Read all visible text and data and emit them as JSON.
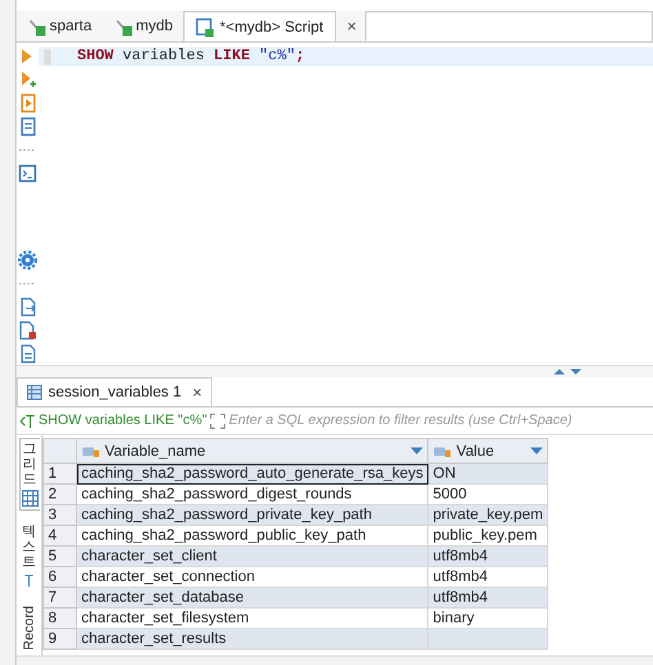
{
  "editor_tabs": [
    {
      "label": "sparta",
      "kind": "connection",
      "selected": false
    },
    {
      "label": "mydb",
      "kind": "connection",
      "selected": false
    },
    {
      "label": "*<mydb> Script",
      "kind": "script",
      "selected": true,
      "close": "×"
    }
  ],
  "editor": {
    "tokens": [
      {
        "text": "SHOW",
        "kind": "keyword"
      },
      {
        "text": " variables ",
        "kind": "plain"
      },
      {
        "text": "LIKE",
        "kind": "keyword"
      },
      {
        "text": " \"c%\"",
        "kind": "string"
      },
      {
        "text": ";",
        "kind": "keyword"
      }
    ]
  },
  "results_tab": {
    "label": "session_variables 1",
    "close": "×"
  },
  "filter": {
    "query": "SHOW variables LIKE \"c%\"",
    "placeholder": "Enter a SQL expression to filter results (use Ctrl+Space)"
  },
  "view_tabs": [
    {
      "label": "그리드",
      "kind": "korean",
      "selected": true
    },
    {
      "label": "텍스트",
      "kind": "korean",
      "selected": false
    },
    {
      "label": "Record",
      "kind": "latin",
      "selected": false
    }
  ],
  "table": {
    "columns": [
      "Variable_name",
      "Value"
    ],
    "rows": [
      {
        "num": "1",
        "cells": [
          "caching_sha2_password_auto_generate_rsa_keys",
          "ON"
        ],
        "selected": true
      },
      {
        "num": "2",
        "cells": [
          "caching_sha2_password_digest_rounds",
          "5000"
        ],
        "selected": false
      },
      {
        "num": "3",
        "cells": [
          "caching_sha2_password_private_key_path",
          "private_key.pem"
        ],
        "selected": false
      },
      {
        "num": "4",
        "cells": [
          "caching_sha2_password_public_key_path",
          "public_key.pem"
        ],
        "selected": false
      },
      {
        "num": "5",
        "cells": [
          "character_set_client",
          "utf8mb4"
        ],
        "selected": false
      },
      {
        "num": "6",
        "cells": [
          "character_set_connection",
          "utf8mb4"
        ],
        "selected": false
      },
      {
        "num": "7",
        "cells": [
          "character_set_database",
          "utf8mb4"
        ],
        "selected": false
      },
      {
        "num": "8",
        "cells": [
          "character_set_filesystem",
          "binary"
        ],
        "selected": false
      },
      {
        "num": "9",
        "cells": [
          "character_set_results",
          ""
        ],
        "selected": false
      }
    ]
  }
}
